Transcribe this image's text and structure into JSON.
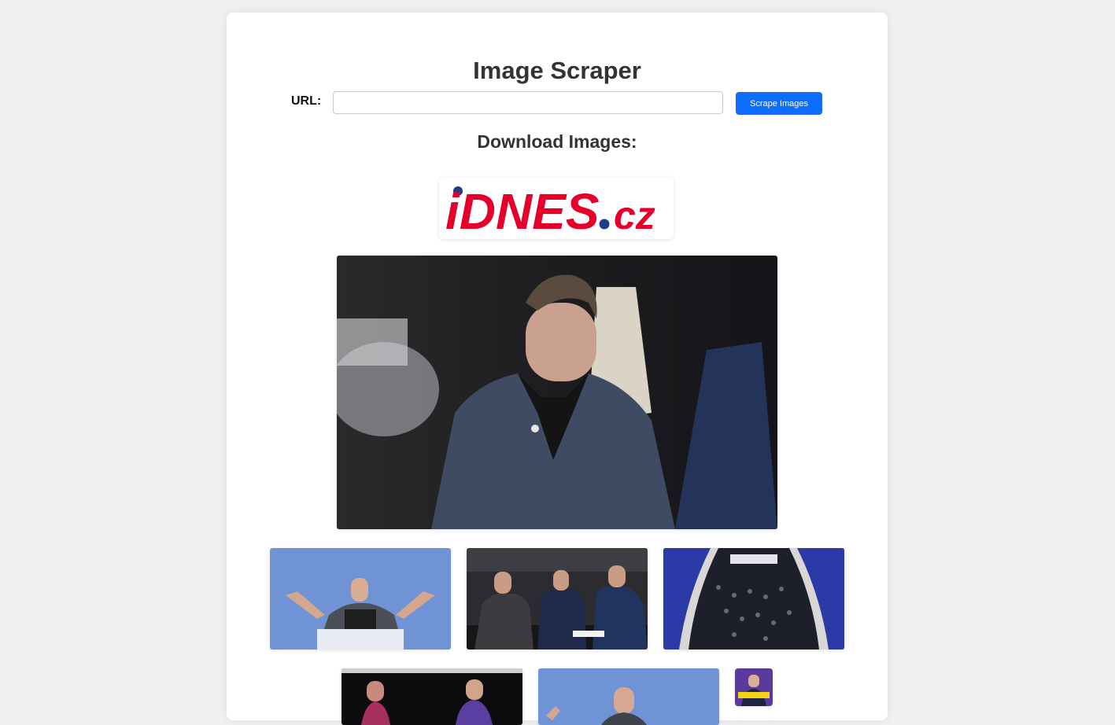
{
  "app": {
    "title": "Image Scraper"
  },
  "form": {
    "url_label": "URL:",
    "url_value": "",
    "url_placeholder": "",
    "submit_label": "Scrape Images"
  },
  "results": {
    "heading": "Download Images:",
    "logo_text": {
      "part1": "iDNES",
      "part2": ".cz"
    }
  },
  "colors": {
    "button": "#0d6efd",
    "logo_red": "#e4002b",
    "logo_dot": "#1f3c88",
    "page_bg": "#f0f0f0"
  }
}
